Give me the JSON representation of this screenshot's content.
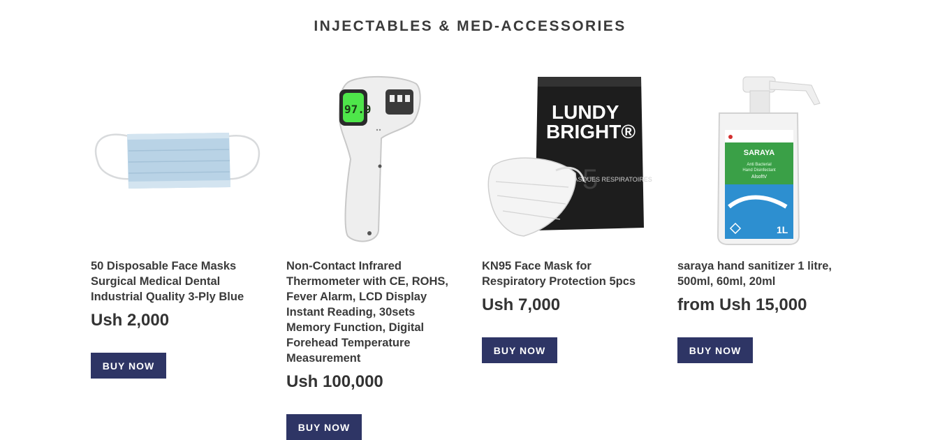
{
  "section": {
    "title": "INJECTABLES & MED-ACCESSORIES"
  },
  "products": [
    {
      "title": "50 Disposable Face Masks Surgical Medical Dental Industrial Quality 3-Ply Blue",
      "price": "Ush 2,000",
      "button": "BUY NOW",
      "image_icon": "face-mask-icon"
    },
    {
      "title": "Non-Contact Infrared Thermometer with CE, ROHS, Fever Alarm, LCD Display Instant Reading, 30sets Memory Function, Digital Forehead Temperature Measurement",
      "price": "Ush 100,000",
      "button": "BUY NOW",
      "image_icon": "thermometer-icon",
      "display_reading": "97.9"
    },
    {
      "title": "KN95 Face Mask for Respiratory Protection 5pcs",
      "price": "Ush 7,000",
      "button": "BUY NOW",
      "image_icon": "kn95-mask-pack-icon",
      "package_text": {
        "brand_line1": "LUNDY",
        "brand_line2": "BRIGHT®",
        "count": "5",
        "sub": "MASQUES RESPIRATOIRES"
      }
    },
    {
      "title": "saraya hand sanitizer 1 litre, 500ml, 60ml, 20ml",
      "price": "from Ush 15,000",
      "button": "BUY NOW",
      "image_icon": "sanitizer-bottle-icon",
      "label_text": {
        "brand": "SARAYA",
        "line1": "Anti Bacterial",
        "line2": "Hand Disinfectant",
        "line3": "AlsoftV",
        "volume": "1L"
      }
    }
  ],
  "colors": {
    "button_bg": "#2e3565",
    "button_text": "#ffffff",
    "heading": "#3a3a3a",
    "text": "#333333"
  }
}
